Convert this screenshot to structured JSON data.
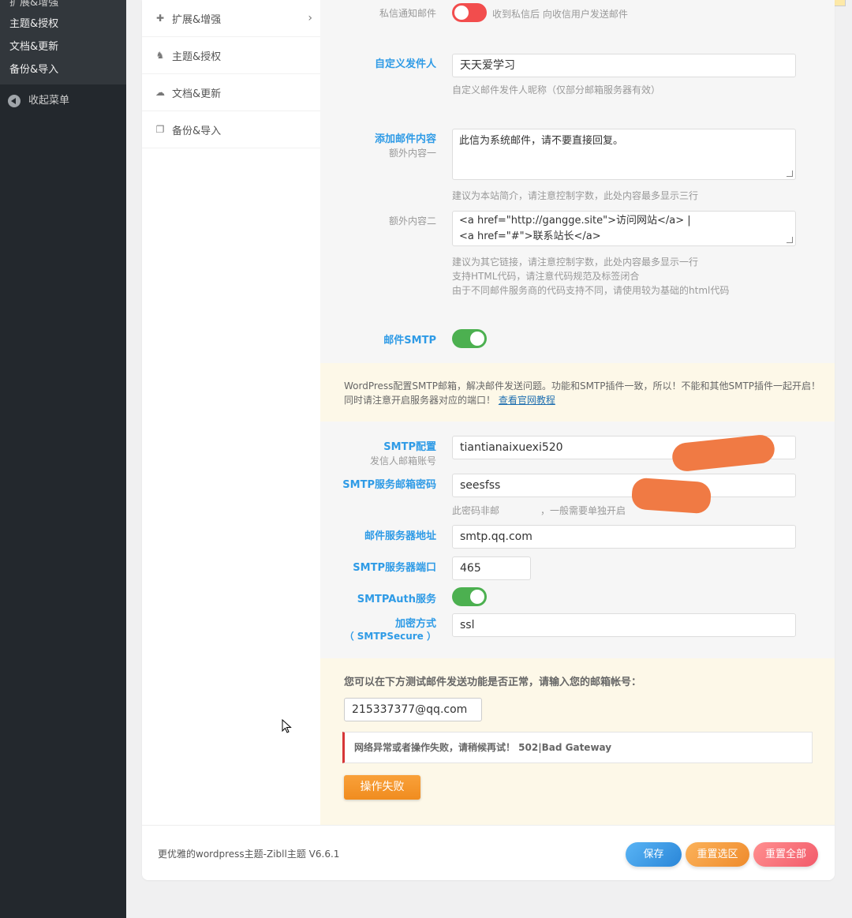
{
  "sidebar": {
    "submenu": [
      "扩展&增强",
      "主题&授权",
      "文档&更新",
      "备份&导入"
    ],
    "collapse_label": "收起菜单"
  },
  "options_nav": {
    "items": [
      {
        "label": "扩展&增强",
        "icon": "puzzle-icon",
        "glyph": "✚"
      },
      {
        "label": "主题&授权",
        "icon": "gitlab-icon",
        "glyph": "♞"
      },
      {
        "label": "文档&更新",
        "icon": "cloud-download-icon",
        "glyph": "☁"
      },
      {
        "label": "备份&导入",
        "icon": "copy-icon",
        "glyph": "❐"
      }
    ]
  },
  "settings": {
    "private_msg_mail": {
      "label": "私信通知邮件",
      "state": "off",
      "text": "收到私信后 向收信用户发送邮件"
    },
    "custom_sender": {
      "label": "自定义发件人",
      "value": "天天爱学习",
      "help": "自定义邮件发件人昵称（仅部分邮箱服务器有效）"
    },
    "mail_content": {
      "label": "添加邮件内容",
      "sub1": "额外内容一",
      "value1": "此信为系统邮件，请不要直接回复。",
      "help1": "建议为本站简介，请注意控制字数，此处内容最多显示三行",
      "sub2": "额外内容二",
      "value2_line1": "<a href=\"http://gangge.site\">访问网站</a> |",
      "value2_line2": "<a href=\"#\">联系站长</a>",
      "help2_1": "建议为其它链接，请注意控制字数，此处内容最多显示一行",
      "help2_2": "支持HTML代码，请注意代码规范及标签闭合",
      "help2_3": "由于不同邮件服务商的代码支持不同，请使用较为基础的html代码"
    },
    "smtp_toggle": {
      "label": "邮件SMTP",
      "state": "on"
    },
    "notice": {
      "line1": "WordPress配置SMTP邮箱，解决邮件发送问题。功能和SMTP插件一致，所以！不能和其他SMTP插件一起开启！",
      "line2": "同时请注意开启服务器对应的端口！",
      "link": "查看官网教程"
    },
    "smtp_config": {
      "label": "SMTP配置",
      "sub": "发信人邮箱账号",
      "value": "tiantianaixuexi520"
    },
    "smtp_password": {
      "label": "SMTP服务邮箱密码",
      "value": "seesfss",
      "help_pre": "此密码非邮",
      "help_post": "，一般需要单独开启"
    },
    "smtp_host": {
      "label": "邮件服务器地址",
      "value": "smtp.qq.com"
    },
    "smtp_port": {
      "label": "SMTP服务器端口",
      "value": "465"
    },
    "smtp_auth": {
      "label": "SMTPAuth服务",
      "state": "on"
    },
    "smtp_secure": {
      "label": "加密方式",
      "label2": "（ SMTPSecure ）",
      "value": "ssl"
    }
  },
  "test": {
    "title": "您可以在下方测试邮件发送功能是否正常，请输入您的邮箱帐号：",
    "email": "215337377@qq.com",
    "error": "网络异常或者操作失败，请稍候再试！ 502|Bad Gateway",
    "button": "操作失败"
  },
  "footer": {
    "text": "更优雅的wordpress主题-Zibll主题 V6.6.1",
    "save": "保存",
    "reset_section": "重置选区",
    "reset_all": "重置全部"
  },
  "colors": {
    "accent": "#2f9be6",
    "toggle_on": "#4cb050",
    "toggle_off": "#f24d4d",
    "notice_bg": "#fdf8e8"
  }
}
